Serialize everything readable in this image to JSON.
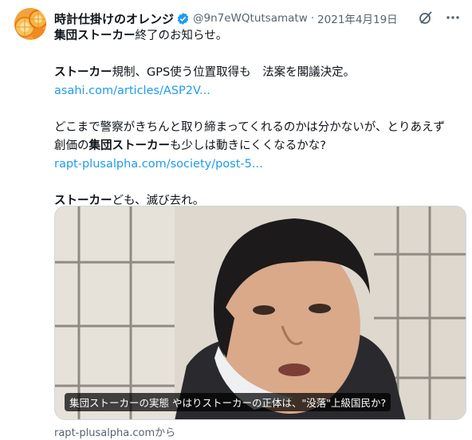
{
  "tweet": {
    "display_name": "時計仕掛けのオレンジ",
    "handle": "@9n7eWQtutsamatw",
    "separator": "·",
    "date": "2021年4月19日",
    "line1_bold": "集団ストーカー",
    "line1_rest": "終了のお知らせ。",
    "line2_bold": "ストーカー",
    "line2_rest": "規制、GPS使う位置取得も　法案を閣議決定。",
    "link1": "asahi.com/articles/ASP2V...",
    "line3": "どこまで警察がきちんと取り締まってくれるのかは分かないが、とりあえず",
    "line4_a": "創価の",
    "line4_bold": "集団ストーカー",
    "line4_b": "も少しは動きにくくなるかな?",
    "link2": "rapt-plusalpha.com/society/post-5...",
    "line5_bold": "ストーカー",
    "line5_rest": "ども、滅び去れ。"
  },
  "card": {
    "caption": "集団ストーカーの実態 やはりストーカーの正体は、\"没落\"上級国民か?",
    "source": "rapt-plusalpha.comから"
  },
  "icons": {
    "avatar": "orange-slices-avatar",
    "verified": "verified-badge-icon",
    "grok": "grok-icon",
    "more": "more-options-icon"
  },
  "colors": {
    "link": "#1d9bf0",
    "verified": "#1d9bf0",
    "muted": "#536471",
    "text": "#0f1419"
  }
}
